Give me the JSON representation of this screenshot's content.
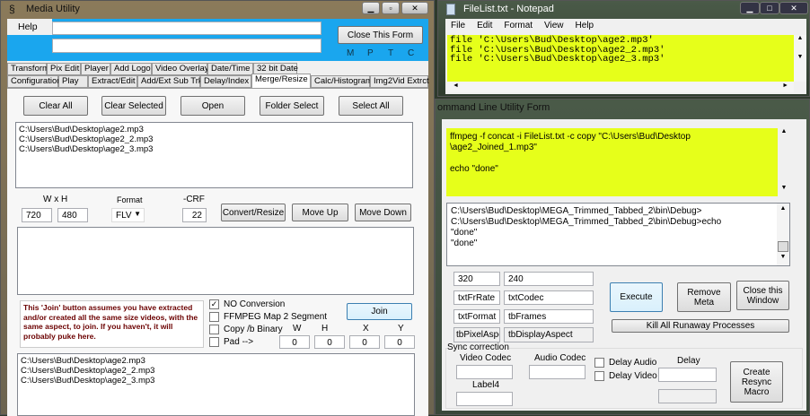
{
  "media_utility": {
    "title": "Media Utility",
    "help": "Help",
    "close_form": "Close This Form",
    "letters": [
      "M",
      "P",
      "T",
      "C"
    ],
    "tabs_row1": [
      "Transform",
      "Pix Edit",
      "Player",
      "Add Logo",
      "Video Overlay",
      "Date/Time",
      "32 bit Date"
    ],
    "tabs_row2": [
      "Configuration",
      "Play",
      "Extract/Edit",
      "Add/Ext Sub Trk",
      "Delay/Index",
      "Merge/Resize",
      "Calc/Histogram",
      "Img2Vid Extrct"
    ],
    "buttons": {
      "clear_all": "Clear All",
      "clear_selected": "Clear Selected",
      "open": "Open",
      "folder_select": "Folder Select",
      "select_all": "Select All"
    },
    "files": [
      "C:\\Users\\Bud\\Desktop\\age2.mp3",
      "C:\\Users\\Bud\\Desktop\\age2_2.mp3",
      "C:\\Users\\Bud\\Desktop\\age2_3.mp3"
    ],
    "wxh_label": "W x H",
    "width": "720",
    "height": "480",
    "format_label": "Format",
    "format": "FLV",
    "crf_label": "-CRF",
    "crf": "22",
    "convert": "Convert/Resize",
    "move_up": "Move Up",
    "move_down": "Move Down",
    "join_note": "This 'Join' button assumes you have extracted  and/or created all the same size videos, with the same aspect, to join.  If you haven't, it will probably puke here.",
    "checks": [
      {
        "label": "NO Conversion",
        "checked": true
      },
      {
        "label": "FFMPEG Map 2 Segment",
        "checked": false
      },
      {
        "label": "Copy /b Binary",
        "checked": false
      },
      {
        "label": "Pad  -->",
        "checked": false
      }
    ],
    "join": "Join",
    "pad": {
      "w_label": "W",
      "h_label": "H",
      "x_label": "X",
      "y_label": "Y",
      "w": "0",
      "h": "0",
      "x": "0",
      "y": "0"
    },
    "bottom_files": [
      "C:\\Users\\Bud\\Desktop\\age2.mp3",
      "C:\\Users\\Bud\\Desktop\\age2_2.mp3",
      "C:\\Users\\Bud\\Desktop\\age2_3.mp3"
    ]
  },
  "notepad": {
    "title": "FileList.txt - Notepad",
    "menu": [
      "File",
      "Edit",
      "Format",
      "View",
      "Help"
    ],
    "lines": [
      "file 'C:\\Users\\Bud\\Desktop\\age2.mp3'",
      "file 'C:\\Users\\Bud\\Desktop\\age2_2.mp3'",
      "file 'C:\\Users\\Bud\\Desktop\\age2_3.mp3'"
    ]
  },
  "cmd": {
    "title": "ommand Line Utility Form",
    "command_lines": [
      "ffmpeg -f concat -i FileList.txt -c copy \"C:\\Users\\Bud\\Desktop",
      "\\age2_Joined_1.mp3\"",
      "",
      "echo \"done\""
    ],
    "output_lines": [
      "C:\\Users\\Bud\\Desktop\\MEGA_Trimmed_Tabbed_2\\bin\\Debug>",
      "C:\\Users\\Bud\\Desktop\\MEGA_Trimmed_Tabbed_2\\bin\\Debug>echo",
      "\"done\"",
      "\"done\""
    ],
    "fields": {
      "w": "320",
      "h": "240",
      "fr_rate": "txtFrRate",
      "codec": "txtCodec",
      "format": "txtFormat",
      "frames": "tbFrames",
      "pixel_aspect": "tbPixelAspec",
      "display_aspect": "tbDisplayAspect"
    },
    "execute": "Execute",
    "remove_meta": "Remove Meta",
    "close_window": "Close this Window",
    "kill_all": "Kill All Runaway Processes",
    "sync": {
      "title": "Sync correction",
      "video_codec": "Video Codec",
      "audio_codec": "Audio Codec",
      "label4": "Label4",
      "delay_audio": "Delay Audio",
      "delay_video": "Delay Video",
      "delay": "Delay",
      "create": "Create Resync Macro"
    }
  }
}
